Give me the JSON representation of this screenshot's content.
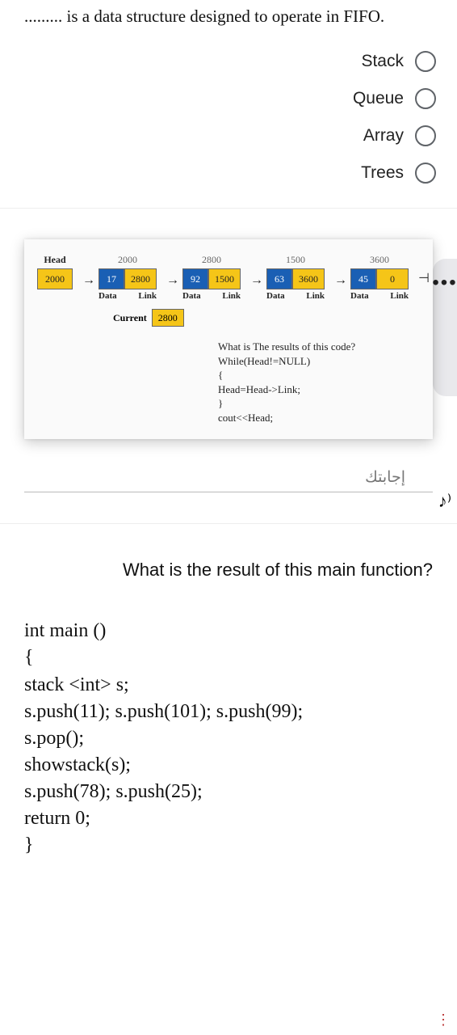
{
  "q1": {
    "text": "......... is a data structure designed to operate in FIFO.",
    "options": [
      "Stack",
      "Queue",
      "Array",
      "Trees"
    ]
  },
  "overflow_dots": "•••",
  "music_icon": "♪⁾",
  "q2": {
    "head_label": "Head",
    "head_addr": "2000",
    "data_label": "Data",
    "link_label": "Link",
    "current_label": "Current",
    "current_val": "2800",
    "nodes": [
      {
        "addr": "2000",
        "data": "17",
        "link": "2800"
      },
      {
        "addr": "2800",
        "data": "92",
        "link": "1500"
      },
      {
        "addr": "1500",
        "data": "63",
        "link": "3600"
      },
      {
        "addr": "3600",
        "data": "45",
        "link": "0"
      }
    ],
    "code": [
      "What is The results of this code?",
      "While(Head!=NULL)",
      "{",
      "Head=Head->Link;",
      "}",
      "cout<<Head;"
    ],
    "answer_label": "إجابتك"
  },
  "q3": {
    "title": "?What is the result of this main function",
    "code": [
      "int main ()",
      "{",
      "stack <int> s;",
      "s.push(11); s.push(101); s.push(99);",
      "s.pop();",
      "showstack(s);",
      "s.push(78); s.push(25);",
      "return 0;",
      "}"
    ]
  },
  "bottom_icon": "⋮"
}
